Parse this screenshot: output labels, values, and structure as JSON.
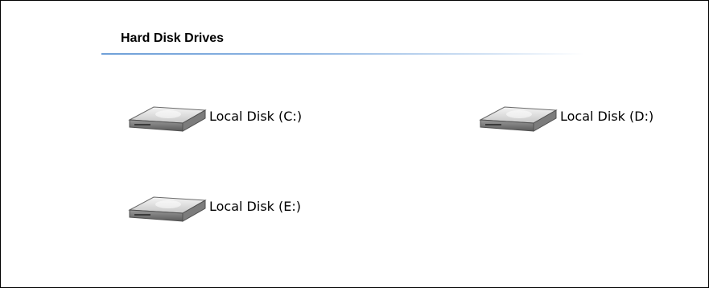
{
  "section": {
    "title": "Hard Disk Drives",
    "rule_color": "#6fa0d8"
  },
  "drives": [
    {
      "label": "Local Disk (C:)",
      "icon": "hard-disk-icon"
    },
    {
      "label": "Local Disk (D:)",
      "icon": "hard-disk-icon"
    },
    {
      "label": "Local Disk (E:)",
      "icon": "hard-disk-icon"
    }
  ]
}
